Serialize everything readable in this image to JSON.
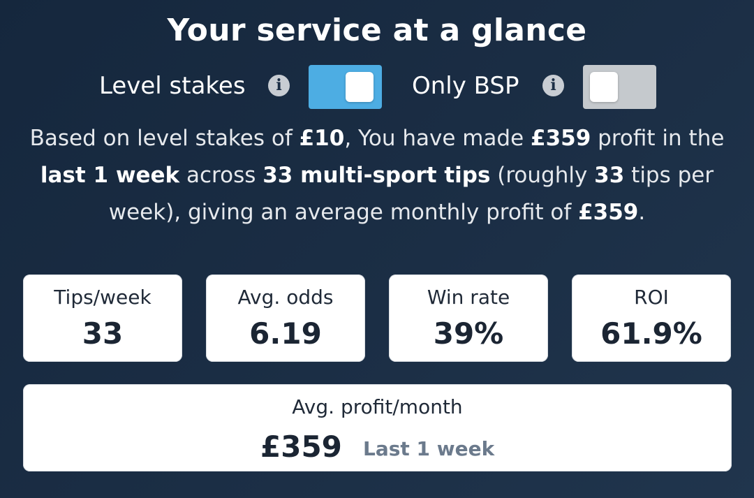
{
  "title": "Your service at a glance",
  "toggles": {
    "level_stakes": {
      "label": "Level stakes",
      "on": true
    },
    "only_bsp": {
      "label": "Only BSP",
      "on": false
    }
  },
  "summary": {
    "t1": "Based on level stakes of ",
    "stake": "£10",
    "t2": ", You have made ",
    "profit": "£359",
    "t3": " profit in the ",
    "period": "last 1 week",
    "t4": " across ",
    "tips": "33 multi-sport tips",
    "t5": " (roughly ",
    "tips_per_week": "33",
    "t6": " tips per week), giving an average monthly profit of ",
    "monthly_profit": "£359",
    "t7": "."
  },
  "stats": [
    {
      "label": "Tips/week",
      "value": "33"
    },
    {
      "label": "Avg. odds",
      "value": "6.19"
    },
    {
      "label": "Win rate",
      "value": "39%"
    },
    {
      "label": "ROI",
      "value": "61.9%"
    }
  ],
  "profit_card": {
    "label": "Avg. profit/month",
    "value": "£359",
    "period": "Last 1 week"
  },
  "colors": {
    "background": "#1b2e45",
    "toggle_on": "#4dade3",
    "toggle_off": "#c5c9cd",
    "muted_text": "#6b7a8c"
  },
  "icons": {
    "info": "info-icon"
  }
}
